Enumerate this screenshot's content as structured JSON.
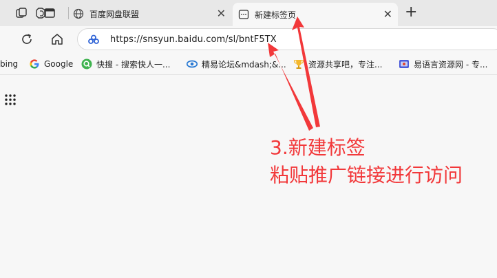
{
  "tabs": [
    {
      "title": "百度网盘联盟",
      "active": false
    },
    {
      "title": "新建标签页",
      "active": true
    }
  ],
  "address_bar": {
    "url": "https://snsyun.baidu.com/sl/bntF5TX"
  },
  "bookmarks": [
    {
      "label": "bing",
      "icon": "bing-icon"
    },
    {
      "label": "Google",
      "icon": "google-icon"
    },
    {
      "label": "快搜 - 搜索快人一...",
      "icon": "kuaisou-icon"
    },
    {
      "label": "精易论坛&mdash;&...",
      "icon": "jingyi-icon"
    },
    {
      "label": "资源共享吧，专注...",
      "icon": "trophy-icon"
    },
    {
      "label": "易语言资源网 - 专...",
      "icon": "yiyuyan-icon"
    }
  ],
  "annotation": {
    "line1": "3.新建标签",
    "line2": "粘贴推广链接进行访问",
    "color": "#f2383a"
  },
  "colors": {
    "accent": "#f2383a",
    "tabstrip": "#e8e8e8",
    "page": "#f7f7f7"
  }
}
